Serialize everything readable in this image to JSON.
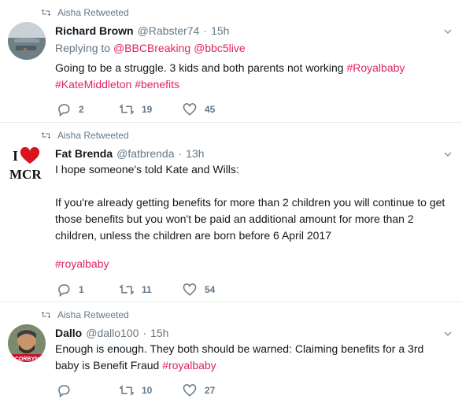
{
  "colors": {
    "accent": "#e0245e",
    "muted": "#657786",
    "text": "#14171a",
    "divider": "#e6ecf0"
  },
  "tweets": [
    {
      "retweeted_by": "Aisha Retweeted",
      "name": "Richard Brown",
      "handle": "@Rabster74",
      "dot": "·",
      "time": "15h",
      "reply_prefix": "Replying to",
      "reply_mentions": [
        "@BBCBreaking",
        "@bbc5live"
      ],
      "text_plain": "Going to be a struggle. 3 kids and both parents not working ",
      "hashtags": [
        "#Royalbaby",
        "#KateMiddleton",
        "#benefits"
      ],
      "replies": "2",
      "retweets": "19",
      "likes": "45",
      "avatar_icon": "sea-photo-avatar"
    },
    {
      "retweeted_by": "Aisha Retweeted",
      "name": "Fat Brenda",
      "handle": "@fatbrenda",
      "dot": "·",
      "time": "13h",
      "text_line1": "I hope someone's told Kate and Wills:",
      "text_line2": "If you're already getting benefits for more than 2 children you will continue to get those benefits but you won't be paid an additional amount for more than 2 children, unless the children are born before 6 April 2017",
      "hashtag": "#royalbaby",
      "replies": "1",
      "retweets": "11",
      "likes": "54",
      "avatar_icon": "i-love-mcr-logo",
      "avatar_text_top": "I",
      "avatar_text_bottom": "MCR"
    },
    {
      "retweeted_by": "Aisha Retweeted",
      "name": "Dallo",
      "handle": "@dallo100",
      "dot": "·",
      "time": "15h",
      "text_plain": "Enough is enough.  They both should be warned:  Claiming benefits for a 3rd baby is Benefit Fraud ",
      "hashtag": "#royalbaby",
      "replies": "",
      "retweets": "10",
      "likes": "27",
      "avatar_icon": "man-photo-avatar",
      "avatar_badge": "CORBYN"
    }
  ]
}
